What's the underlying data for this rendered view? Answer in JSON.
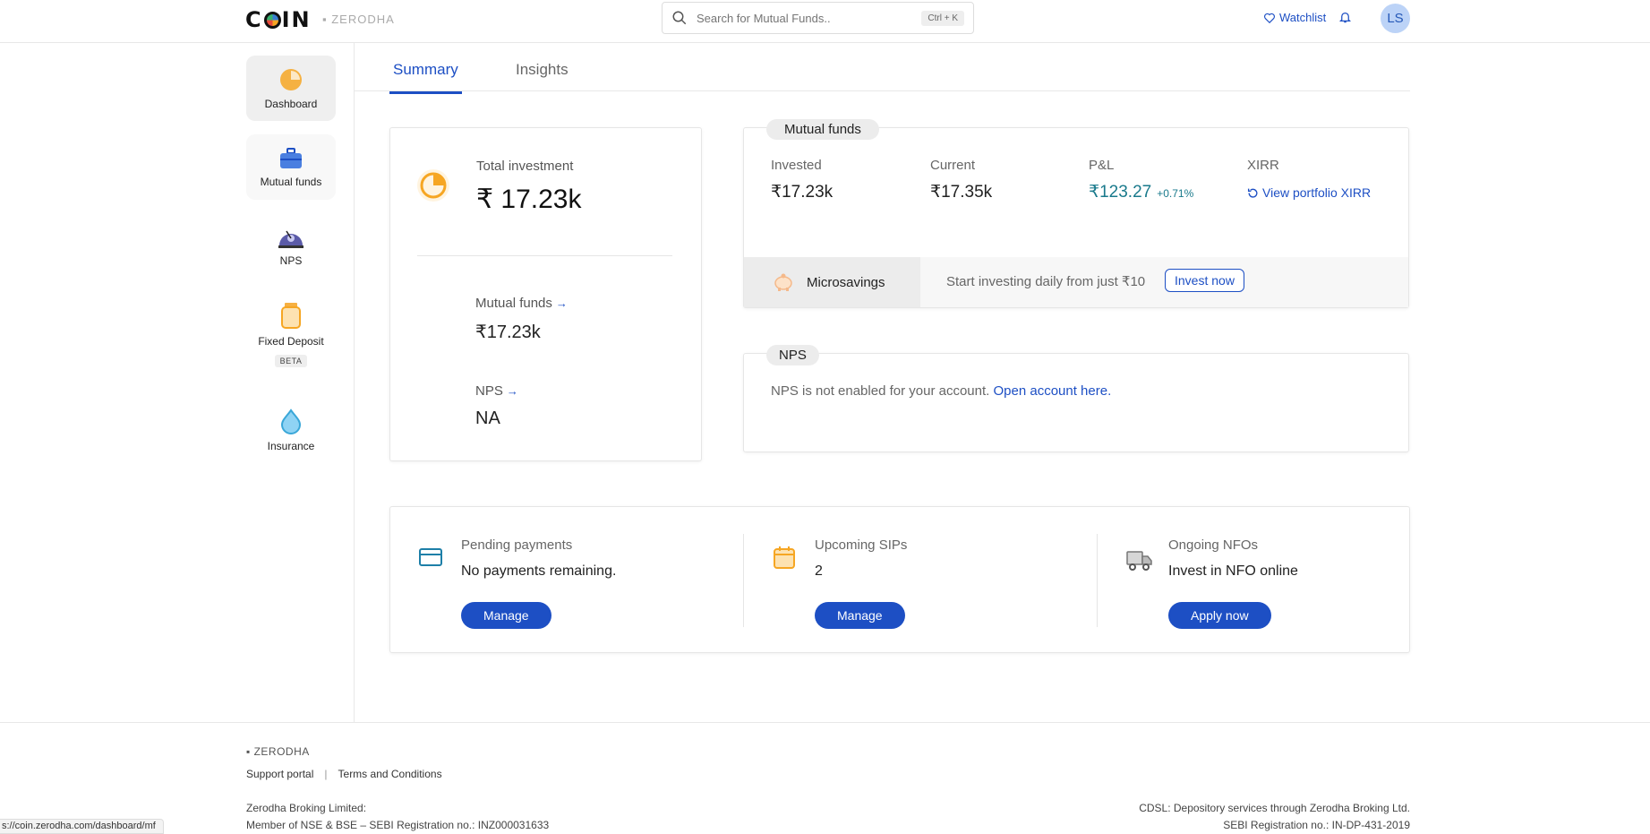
{
  "header": {
    "logo": "COIN",
    "brand_sub": "ZERODHA",
    "search_placeholder": "Search for Mutual Funds..",
    "search_shortcut": "Ctrl + K",
    "watchlist": "Watchlist",
    "avatar_initials": "LS"
  },
  "sidebar": {
    "items": [
      {
        "label": "Dashboard",
        "icon": "pie-chart-icon"
      },
      {
        "label": "Mutual funds",
        "icon": "briefcase-icon"
      },
      {
        "label": "NPS",
        "icon": "nps-icon"
      },
      {
        "label": "Fixed Deposit",
        "icon": "jar-icon",
        "badge": "BETA"
      },
      {
        "label": "Insurance",
        "icon": "drop-icon"
      }
    ]
  },
  "tabs": [
    {
      "label": "Summary",
      "active": true
    },
    {
      "label": "Insights",
      "active": false
    }
  ],
  "total": {
    "label": "Total investment",
    "value": "₹ 17.23k",
    "mf_label": "Mutual funds",
    "mf_value": "₹17.23k",
    "nps_label": "NPS",
    "nps_value": "NA"
  },
  "mutual_funds": {
    "title": "Mutual funds",
    "invested_label": "Invested",
    "invested_value": "₹17.23k",
    "current_label": "Current",
    "current_value": "₹17.35k",
    "pl_label": "P&L",
    "pl_value": "₹123.27",
    "pl_pct": "+0.71%",
    "xirr_label": "XIRR",
    "xirr_link": "View portfolio XIRR",
    "micro_label": "Microsavings",
    "micro_text": "Start investing daily from just ₹10",
    "micro_button": "Invest now"
  },
  "nps": {
    "title": "NPS",
    "text": "NPS is not enabled for your account.",
    "link": "Open account here."
  },
  "actions": [
    {
      "label": "Pending payments",
      "desc": "No payments remaining.",
      "button": "Manage",
      "icon": "card-icon"
    },
    {
      "label": "Upcoming SIPs",
      "desc": "2",
      "button": "Manage",
      "icon": "calendar-icon"
    },
    {
      "label": "Ongoing NFOs",
      "desc": "Invest in NFO online",
      "button": "Apply now",
      "icon": "truck-icon"
    }
  ],
  "footer": {
    "brand": "ZERODHA",
    "link1": "Support portal",
    "link_sep": "|",
    "link2": "Terms and Conditions",
    "left_line1": "Zerodha Broking Limited:",
    "left_line2": "Member of NSE & BSE – SEBI Registration no.: INZ000031633",
    "right_line1": "CDSL: Depository services through Zerodha Broking Ltd.",
    "right_line2": "SEBI Registration no.: IN-DP-431-2019"
  },
  "status_url": "s://coin.zerodha.com/dashboard/mf",
  "colors": {
    "accent": "#1d4fc4",
    "pl": "#1a7a8c",
    "orange": "#f6a623"
  }
}
